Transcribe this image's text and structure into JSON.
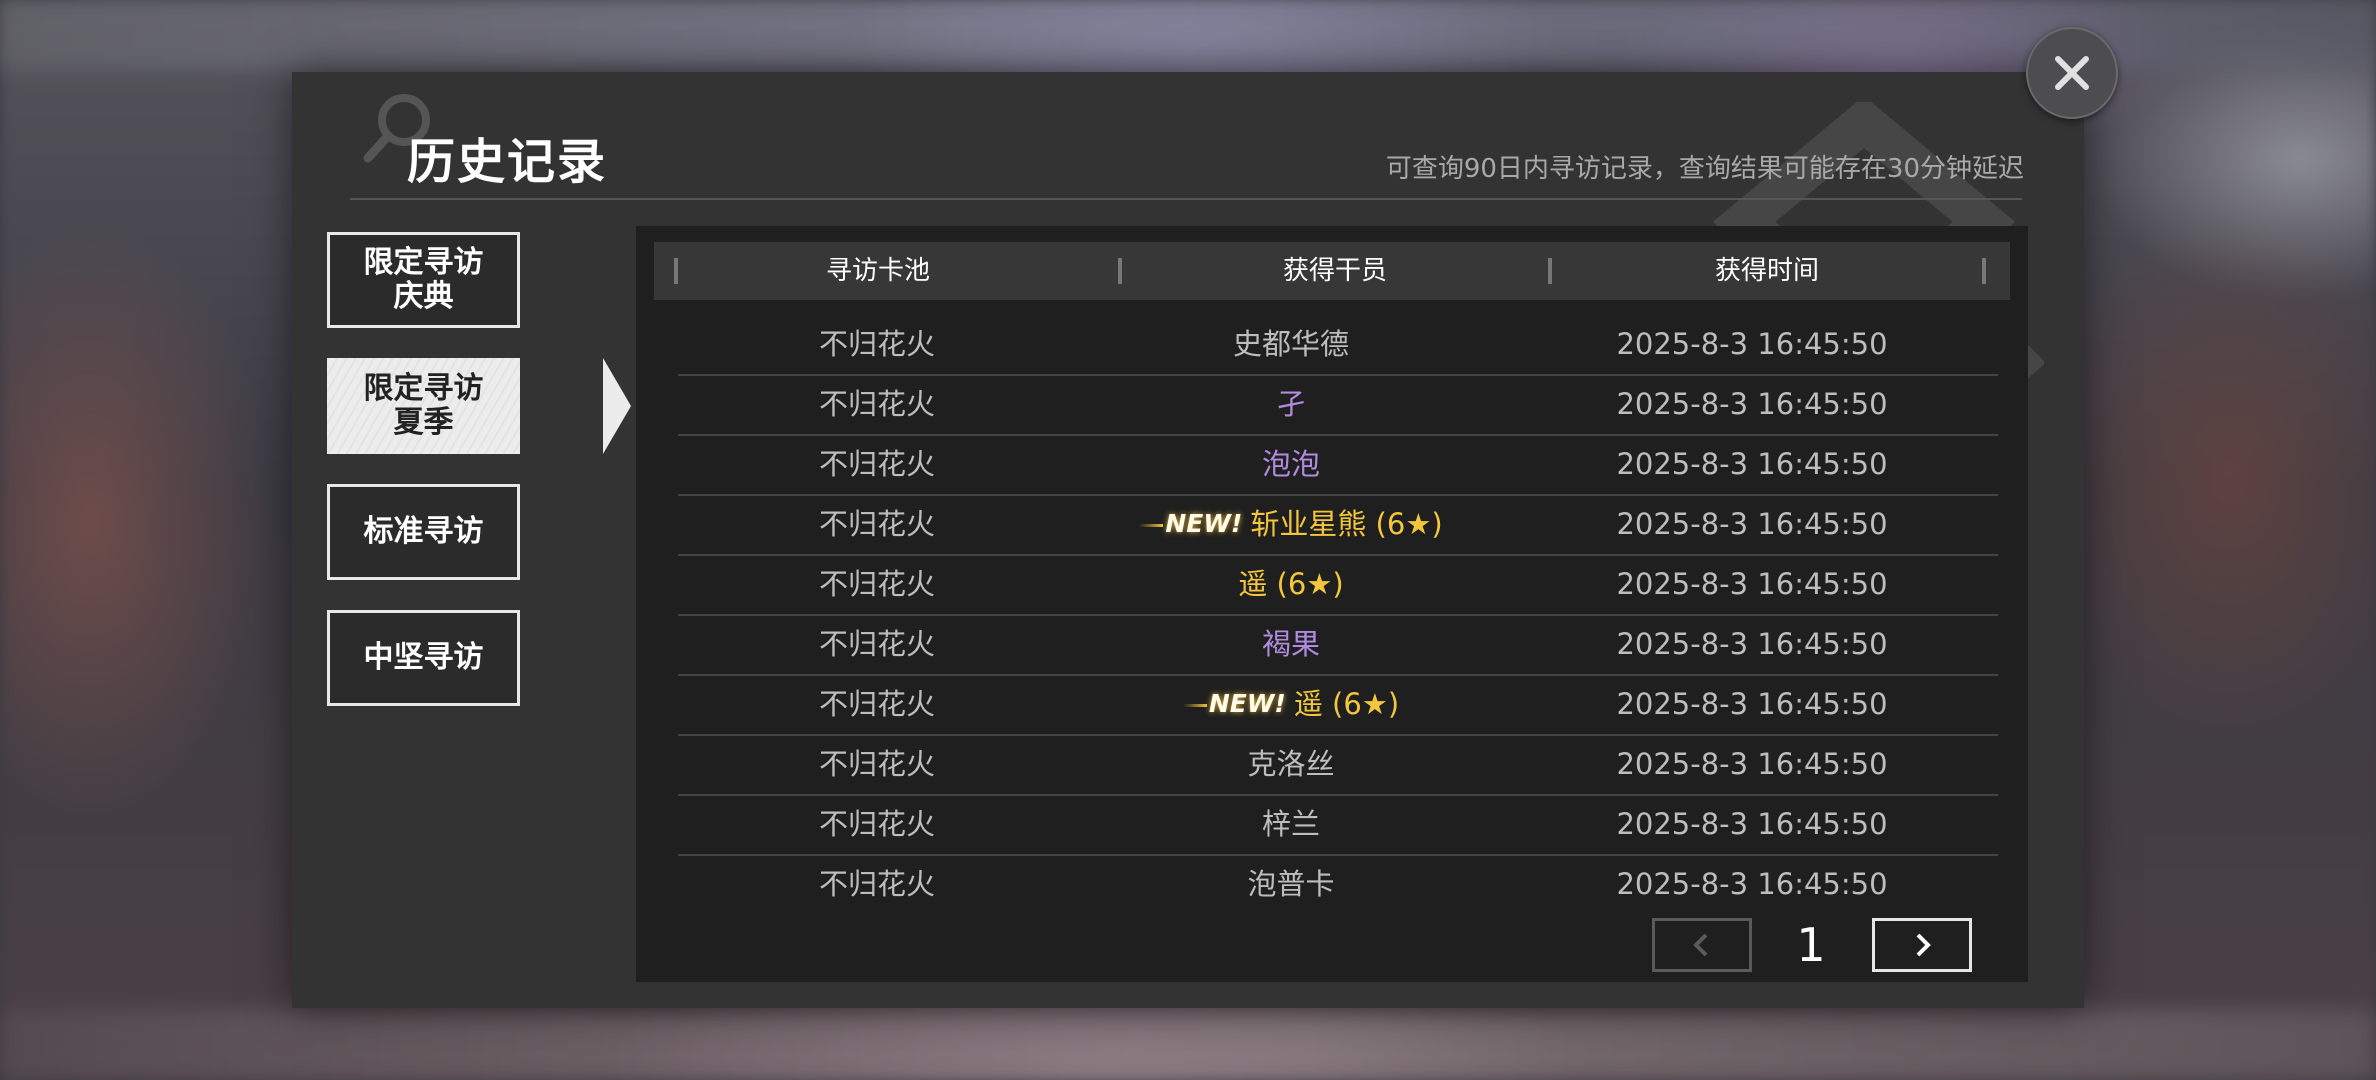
{
  "dialog": {
    "title": "历史记录",
    "subtitle": "可查询90日内寻访记录，查询结果可能存在30分钟延迟"
  },
  "tabs": [
    {
      "line1": "限定寻访",
      "line2": "庆典",
      "active": false
    },
    {
      "line1": "限定寻访",
      "line2": "夏季",
      "active": true
    },
    {
      "line1": "标准寻访",
      "line2": "",
      "active": false
    },
    {
      "line1": "中坚寻访",
      "line2": "",
      "active": false
    }
  ],
  "table": {
    "headers": [
      "寻访卡池",
      "获得干员",
      "获得时间"
    ],
    "rows": [
      {
        "pool": "不归花火",
        "operator": "史都华德",
        "rarity_color": "normal",
        "new": false,
        "time": "2025-8-3 16:45:50"
      },
      {
        "pool": "不归花火",
        "operator": "孑",
        "rarity_color": "purple",
        "new": false,
        "time": "2025-8-3 16:45:50"
      },
      {
        "pool": "不归花火",
        "operator": "泡泡",
        "rarity_color": "purple",
        "new": false,
        "time": "2025-8-3 16:45:50"
      },
      {
        "pool": "不归花火",
        "operator": "斩业星熊 (6★)",
        "rarity_color": "gold",
        "new": true,
        "time": "2025-8-3 16:45:50"
      },
      {
        "pool": "不归花火",
        "operator": "遥 (6★)",
        "rarity_color": "gold",
        "new": false,
        "time": "2025-8-3 16:45:50"
      },
      {
        "pool": "不归花火",
        "operator": "褐果",
        "rarity_color": "purple",
        "new": false,
        "time": "2025-8-3 16:45:50"
      },
      {
        "pool": "不归花火",
        "operator": "遥 (6★)",
        "rarity_color": "gold",
        "new": true,
        "time": "2025-8-3 16:45:50"
      },
      {
        "pool": "不归花火",
        "operator": "克洛丝",
        "rarity_color": "normal",
        "new": false,
        "time": "2025-8-3 16:45:50"
      },
      {
        "pool": "不归花火",
        "operator": "梓兰",
        "rarity_color": "normal",
        "new": false,
        "time": "2025-8-3 16:45:50"
      },
      {
        "pool": "不归花火",
        "operator": "泡普卡",
        "rarity_color": "normal",
        "new": false,
        "time": "2025-8-3 16:45:50"
      }
    ],
    "new_label": "NEW!"
  },
  "pager": {
    "current_page": "1",
    "prev_icon": "chevron-left-icon",
    "next_icon": "chevron-right-icon",
    "prev_disabled": true
  },
  "colors": {
    "panel": "#333334",
    "content": "#1f1f1f",
    "purple": "#b18be0",
    "gold": "#f3c63c"
  }
}
